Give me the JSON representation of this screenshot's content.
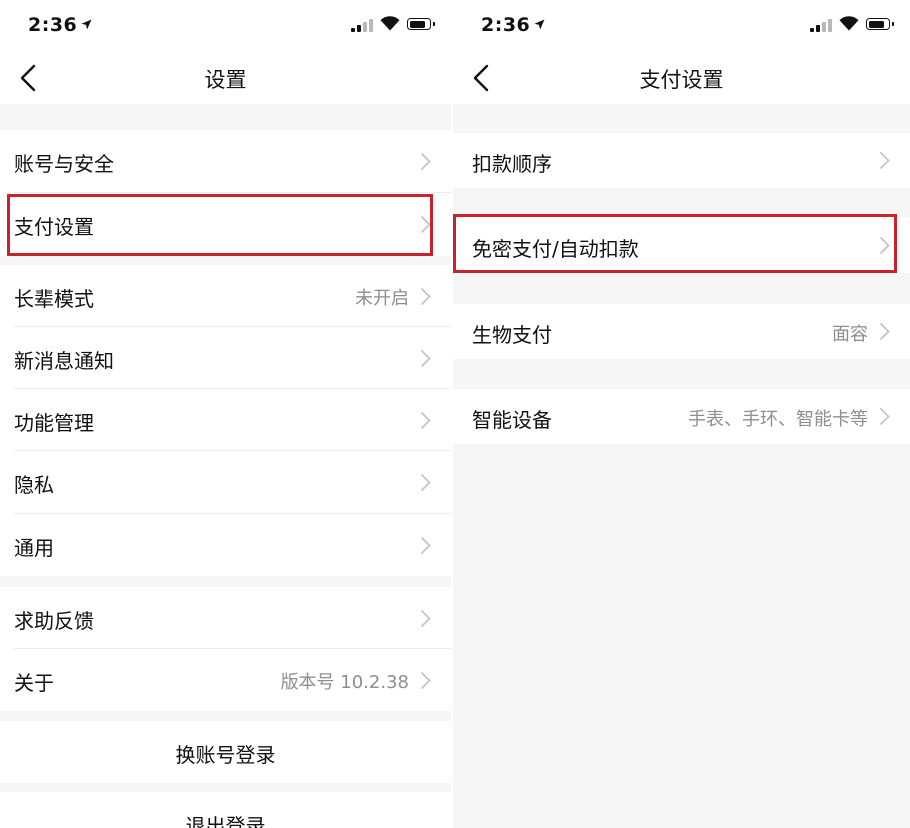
{
  "status_bar": {
    "time": "2:36"
  },
  "left": {
    "title": "设置",
    "items": [
      {
        "label": "账号与安全",
        "value": ""
      },
      {
        "label": "支付设置",
        "value": ""
      },
      {
        "label": "长辈模式",
        "value": "未开启"
      },
      {
        "label": "新消息通知",
        "value": ""
      },
      {
        "label": "功能管理",
        "value": ""
      },
      {
        "label": "隐私",
        "value": ""
      },
      {
        "label": "通用",
        "value": ""
      },
      {
        "label": "求助反馈",
        "value": ""
      },
      {
        "label": "关于",
        "value": "版本号 10.2.38"
      }
    ],
    "switch_account": "换账号登录",
    "logout": "退出登录"
  },
  "right": {
    "title": "支付设置",
    "items": [
      {
        "label": "扣款顺序",
        "value": ""
      },
      {
        "label": "免密支付/自动扣款",
        "value": ""
      },
      {
        "label": "生物支付",
        "value": "面容"
      },
      {
        "label": "智能设备",
        "value": "手表、手环、智能卡等"
      }
    ]
  },
  "colors": {
    "highlight": "#c8232c",
    "background": "#f6f6f6",
    "row": "#ffffff"
  }
}
